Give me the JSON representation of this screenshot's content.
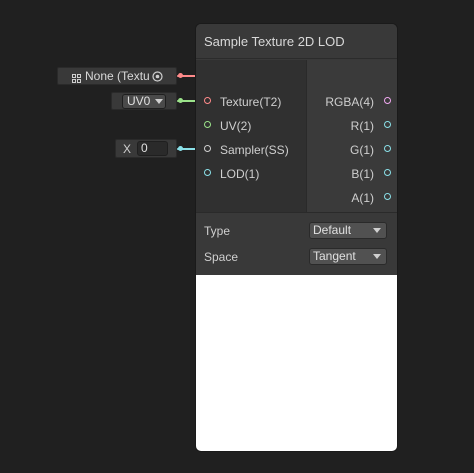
{
  "node": {
    "title": "Sample Texture 2D LOD",
    "inputs": [
      {
        "label": "Texture(T2)",
        "color": "#ff8a8a"
      },
      {
        "label": "UV(2)",
        "color": "#9be38a"
      },
      {
        "label": "Sampler(SS)",
        "color": "#cfcfcf"
      },
      {
        "label": "LOD(1)",
        "color": "#8ae0e8"
      }
    ],
    "outputs": [
      {
        "label": "RGBA(4)",
        "color": "#f0a8f0"
      },
      {
        "label": "R(1)",
        "color": "#8ae0e8"
      },
      {
        "label": "G(1)",
        "color": "#8ae0e8"
      },
      {
        "label": "B(1)",
        "color": "#8ae0e8"
      },
      {
        "label": "A(1)",
        "color": "#8ae0e8"
      }
    ],
    "settings": {
      "type_label": "Type",
      "type_value": "Default",
      "space_label": "Space",
      "space_value": "Tangent"
    }
  },
  "external_inputs": {
    "texture_value": "None (Textu",
    "uv_value": "UV0",
    "lod_axis": "X",
    "lod_value": "0"
  }
}
